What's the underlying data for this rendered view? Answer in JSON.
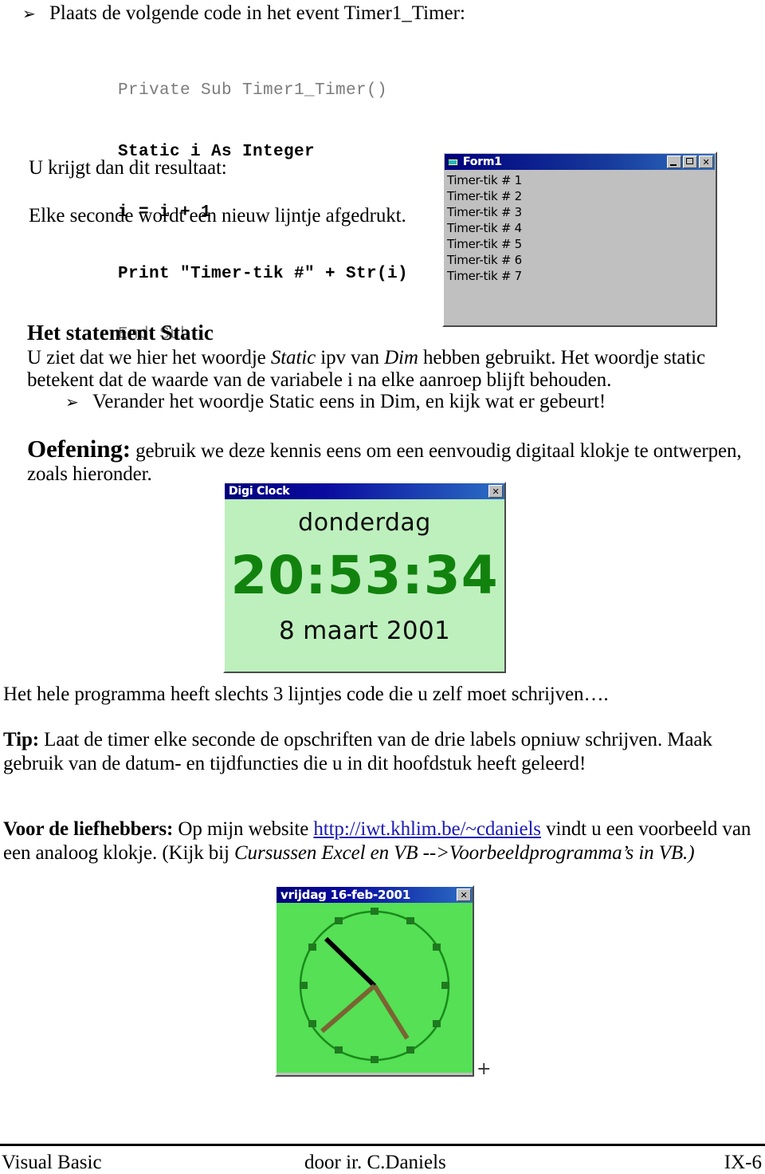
{
  "bullets": {
    "glyph": "➢",
    "top": "Plaats de volgende code in het event Timer1_Timer:",
    "static_change": "Verander het woordje Static eens in Dim, en kijk wat er gebeurt!"
  },
  "code": {
    "line1": "Private Sub Timer1_Timer()",
    "line2": "Static i As Integer",
    "line3": "i = i + 1",
    "line4": "Print \"Timer-tik #\" + Str(i)",
    "line5": "End Sub"
  },
  "paragraphs": {
    "result_intro": "U krijgt dan dit resultaat:",
    "result_note": "Elke seconde wordt een nieuw lijntje afgedrukt.",
    "static_heading": "Het statement Static",
    "static_p_a": "U ziet dat we hier het woordje ",
    "static_p_static": "Static",
    "static_p_b": " ipv van ",
    "static_p_dim": "Dim",
    "static_p_c": " hebben gebruikt. Het woordje static",
    "static_p_line2": "betekent dat de waarde van de variabele i na elke aanroep blijft behouden.",
    "oefening_label": "Oefening:",
    "oefening_text": " gebruik we deze kennis eens om een eenvoudig digitaal klokje te ontwerpen,",
    "oefening_line2": "zoals hieronder.",
    "programma_line": "Het hele programma heeft slechts 3 lijntjes code die u zelf moet schrijven….",
    "tip_label": "Tip:",
    "tip_text": " Laat de timer elke seconde de opschriften van de drie labels opniuw schrijven. Maak",
    "tip_line2": "gebruik van de datum- en tijdfuncties die u in dit hoofdstuk heeft geleerd!",
    "liefhebbers_label": "Voor de liefhebbers:",
    "liefhebbers_a": " Op mijn  website ",
    "liefhebbers_link": "http://iwt.khlim.be/~cdaniels",
    "liefhebbers_b": " vindt u een voorbeeld van",
    "liefhebbers_line2_a": "een analoog klokje. (Kijk bij ",
    "liefhebbers_line2_ital": "Cursussen Excel en VB -->Voorbeeldprogramma’s in VB.)"
  },
  "form1_window": {
    "title": "Form1",
    "minimize_label": "",
    "maximize_label": "",
    "close_label": "✕",
    "lines": [
      "Timer-tik # 1",
      "Timer-tik # 2",
      "Timer-tik # 3",
      "Timer-tik # 4",
      "Timer-tik # 5",
      "Timer-tik # 6",
      "Timer-tik # 7"
    ]
  },
  "digiclock_window": {
    "title": "Digi Clock",
    "close_label": "✕",
    "day": "donderdag",
    "time": "20:53:34",
    "date": "8 maart 2001",
    "bg_color": "#bdf0bd",
    "time_color": "#12820f"
  },
  "analog_window": {
    "title": "vrijdag  16-feb-2001",
    "close_label": "✕",
    "bg_color": "#55e055",
    "dial_color": "#1a8a1a",
    "hand_hour_color": "#7a6433",
    "hand_minute_color": "#7a6433",
    "hand_second_color": "#000000",
    "marker_count": 12,
    "plus_mark": "+"
  },
  "footer": {
    "left": "Visual Basic",
    "center": "door ir. C.Daniels",
    "right": "IX-6"
  }
}
